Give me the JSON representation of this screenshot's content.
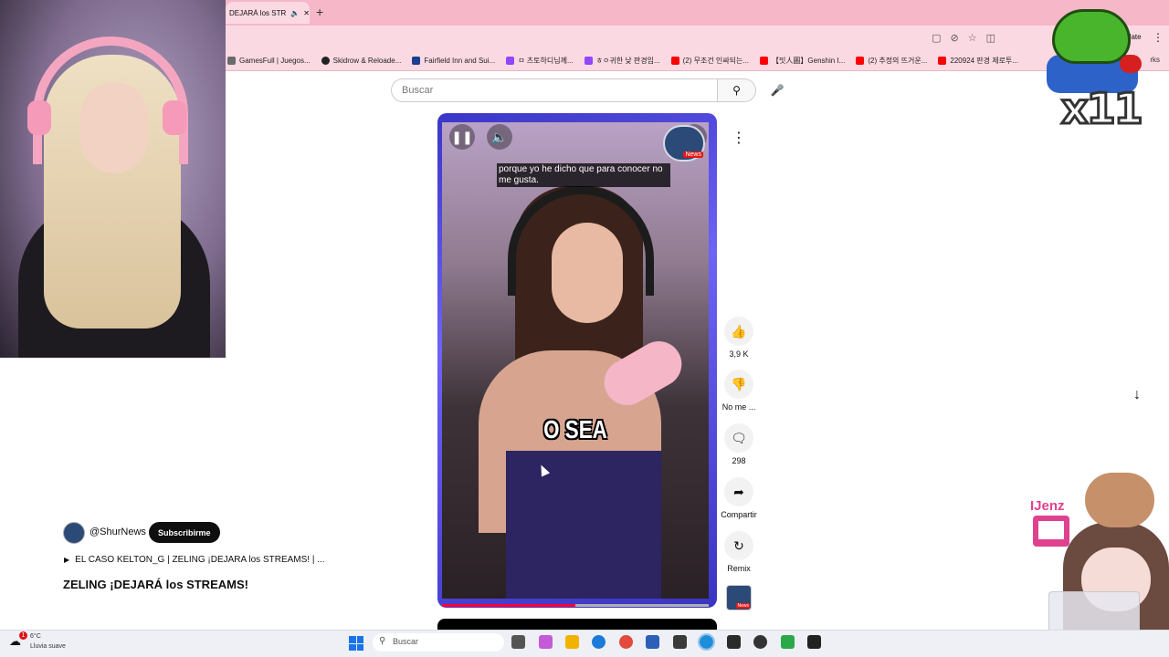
{
  "browser": {
    "active_tab_title": "DEJARÁ los STR",
    "bookmarks": [
      {
        "label": "GamesFull | Juegos...",
        "color": "#6b6b6b"
      },
      {
        "label": "Skidrow & Reloade...",
        "color": "#222222"
      },
      {
        "label": "Fairfield Inn and Sui...",
        "color": "#1a3d8f"
      },
      {
        "label": "ㅁ 츠토하디님께...",
        "color": "#9146ff"
      },
      {
        "label": "ㅎㅇ귀한 낮 판경임...",
        "color": "#9146ff"
      },
      {
        "label": "(2) 무조건 인싸되는...",
        "color": "#ff0000"
      },
      {
        "label": "【밋人圖】Genshin I...",
        "color": "#ff0000"
      },
      {
        "label": "(2) 추정의 뜨거운...",
        "color": "#ff0000"
      },
      {
        "label": "220924 판경 제로투...",
        "color": "#ff0000"
      }
    ],
    "bookmarks_overflow": "rks",
    "update_label": "date"
  },
  "youtube": {
    "search_placeholder": "Buscar",
    "video": {
      "subtitle_line": "porque yo he dicho que para conocer no me gusta.",
      "caption_big": "O SEA",
      "watermark_badge": "News",
      "progress": 0.5
    },
    "actions": {
      "like_count": "3,9 K",
      "dislike_label": "No me ...",
      "comment_count": "298",
      "share_label": "Compartir",
      "remix_label": "Remix",
      "channel_badge": "News"
    },
    "channel": {
      "handle": "@ShurNews",
      "subscribe_label": "Subscribirme",
      "playlist": "EL CASO KELTON_G | ZELING ¡DEJARA los STREAMS! | ...",
      "title": "ZELING ¡DEJARÁ los STREAMS!"
    }
  },
  "overlays": {
    "frog_counter": "x11",
    "streamer_tag": "IJenz"
  },
  "taskbar": {
    "weather_temp": "6°C",
    "weather_condition": "Lluvia suave",
    "weather_badge": "1",
    "search_placeholder": "Buscar",
    "accent_color": "#1a73e8"
  }
}
